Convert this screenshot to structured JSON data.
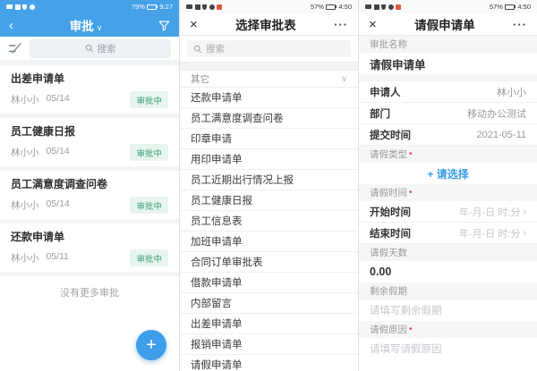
{
  "colors": {
    "primary_blue": "#45a1e8",
    "fab_blue": "#3f9eea",
    "link_blue": "#3a9ee6",
    "badge_green": "#3ba076",
    "badge_green_bg": "#e8f5ee",
    "required_red": "#d9463b"
  },
  "glyphs": {
    "back": "‹",
    "caret_down": "∨",
    "close": "×",
    "more": "···",
    "chevron_right": "›",
    "plus": "+",
    "required_dot": "•"
  },
  "approval_list": {
    "status": {
      "battery": "79%",
      "time": "9:27"
    },
    "nav": {
      "title": "审批"
    },
    "search_placeholder": "搜索",
    "items": [
      {
        "title": "出差申请单",
        "applicant": "林小小",
        "date": "05/14",
        "status": "审批中"
      },
      {
        "title": "员工健康日报",
        "applicant": "林小小",
        "date": "05/14",
        "status": "审批中"
      },
      {
        "title": "员工满意度调查问卷",
        "applicant": "林小小",
        "date": "05/14",
        "status": "审批中"
      },
      {
        "title": "还款申请单",
        "applicant": "林小小",
        "date": "05/11",
        "status": "审批中"
      }
    ],
    "no_more": "没有更多审批"
  },
  "form_picker": {
    "status": {
      "battery": "57%",
      "time": "4:50"
    },
    "nav": {
      "title": "选择审批表"
    },
    "search_placeholder": "搜索",
    "group": "其它",
    "items": [
      "还款申请单",
      "员工满意度调查问卷",
      "印章申请",
      "用印申请单",
      "员工近期出行情况上报",
      "员工健康日报",
      "员工信息表",
      "加班申请单",
      "合同订单审批表",
      "借款申请单",
      "内部留言",
      "出差申请单",
      "报销申请单",
      "请假申请单"
    ]
  },
  "leave_form": {
    "status": {
      "battery": "57%",
      "time": "4:50"
    },
    "nav": {
      "title": "请假申请单"
    },
    "name_label": "审批名称",
    "name_value": "请假申请单",
    "fields": [
      {
        "label": "申请人",
        "value": "林小小"
      },
      {
        "label": "部门",
        "value": "移动办公测试"
      },
      {
        "label": "提交时间",
        "value": "2021-05-11"
      }
    ],
    "type_label": "请假类型",
    "choose_label": "+ 请选择",
    "time_label": "请假时间",
    "start_label": "开始时间",
    "end_label": "结束时间",
    "datetime_placeholder": "年-月-日 时:分",
    "days_label": "请假天数",
    "days_value": "0.00",
    "remaining_label": "剩余假期",
    "remaining_placeholder": "请填写剩余假期",
    "reason_label": "请假原因",
    "reason_placeholder": "请填写请假原因"
  }
}
